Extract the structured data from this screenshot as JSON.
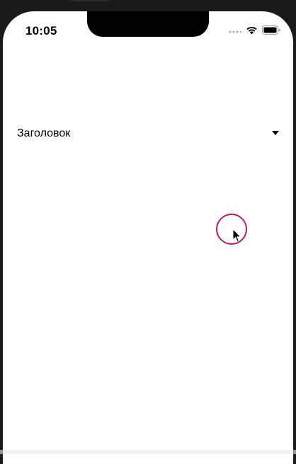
{
  "status_bar": {
    "time": "10:05",
    "icons": [
      "signal-dots-icon",
      "wifi-icon",
      "battery-icon"
    ]
  },
  "header": {
    "title": "Заголовок",
    "toggle_icon": "caret-down-icon"
  },
  "colors": {
    "screen_background": "#ffffff",
    "backdrop": "#1a1a1c",
    "tap_indicator": "#c2185b",
    "text": "#000000"
  }
}
